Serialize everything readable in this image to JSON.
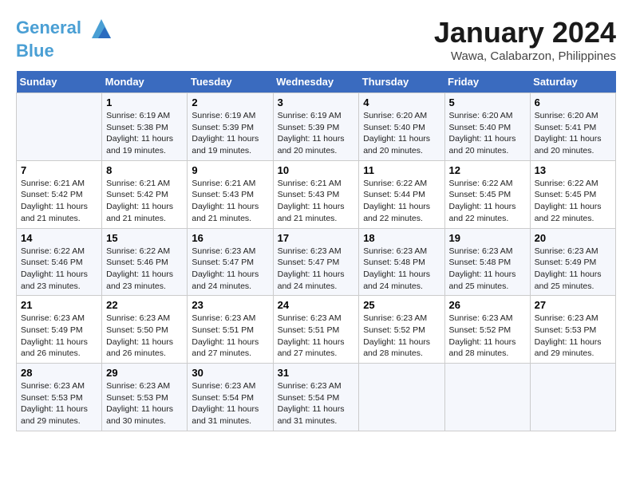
{
  "header": {
    "logo_line1": "General",
    "logo_line2": "Blue",
    "month_title": "January 2024",
    "subtitle": "Wawa, Calabarzon, Philippines"
  },
  "weekdays": [
    "Sunday",
    "Monday",
    "Tuesday",
    "Wednesday",
    "Thursday",
    "Friday",
    "Saturday"
  ],
  "weeks": [
    [
      {
        "day": "",
        "sunrise": "",
        "sunset": "",
        "daylight": ""
      },
      {
        "day": "1",
        "sunrise": "Sunrise: 6:19 AM",
        "sunset": "Sunset: 5:38 PM",
        "daylight": "Daylight: 11 hours and 19 minutes."
      },
      {
        "day": "2",
        "sunrise": "Sunrise: 6:19 AM",
        "sunset": "Sunset: 5:39 PM",
        "daylight": "Daylight: 11 hours and 19 minutes."
      },
      {
        "day": "3",
        "sunrise": "Sunrise: 6:19 AM",
        "sunset": "Sunset: 5:39 PM",
        "daylight": "Daylight: 11 hours and 20 minutes."
      },
      {
        "day": "4",
        "sunrise": "Sunrise: 6:20 AM",
        "sunset": "Sunset: 5:40 PM",
        "daylight": "Daylight: 11 hours and 20 minutes."
      },
      {
        "day": "5",
        "sunrise": "Sunrise: 6:20 AM",
        "sunset": "Sunset: 5:40 PM",
        "daylight": "Daylight: 11 hours and 20 minutes."
      },
      {
        "day": "6",
        "sunrise": "Sunrise: 6:20 AM",
        "sunset": "Sunset: 5:41 PM",
        "daylight": "Daylight: 11 hours and 20 minutes."
      }
    ],
    [
      {
        "day": "7",
        "sunrise": "Sunrise: 6:21 AM",
        "sunset": "Sunset: 5:42 PM",
        "daylight": "Daylight: 11 hours and 21 minutes."
      },
      {
        "day": "8",
        "sunrise": "Sunrise: 6:21 AM",
        "sunset": "Sunset: 5:42 PM",
        "daylight": "Daylight: 11 hours and 21 minutes."
      },
      {
        "day": "9",
        "sunrise": "Sunrise: 6:21 AM",
        "sunset": "Sunset: 5:43 PM",
        "daylight": "Daylight: 11 hours and 21 minutes."
      },
      {
        "day": "10",
        "sunrise": "Sunrise: 6:21 AM",
        "sunset": "Sunset: 5:43 PM",
        "daylight": "Daylight: 11 hours and 21 minutes."
      },
      {
        "day": "11",
        "sunrise": "Sunrise: 6:22 AM",
        "sunset": "Sunset: 5:44 PM",
        "daylight": "Daylight: 11 hours and 22 minutes."
      },
      {
        "day": "12",
        "sunrise": "Sunrise: 6:22 AM",
        "sunset": "Sunset: 5:45 PM",
        "daylight": "Daylight: 11 hours and 22 minutes."
      },
      {
        "day": "13",
        "sunrise": "Sunrise: 6:22 AM",
        "sunset": "Sunset: 5:45 PM",
        "daylight": "Daylight: 11 hours and 22 minutes."
      }
    ],
    [
      {
        "day": "14",
        "sunrise": "Sunrise: 6:22 AM",
        "sunset": "Sunset: 5:46 PM",
        "daylight": "Daylight: 11 hours and 23 minutes."
      },
      {
        "day": "15",
        "sunrise": "Sunrise: 6:22 AM",
        "sunset": "Sunset: 5:46 PM",
        "daylight": "Daylight: 11 hours and 23 minutes."
      },
      {
        "day": "16",
        "sunrise": "Sunrise: 6:23 AM",
        "sunset": "Sunset: 5:47 PM",
        "daylight": "Daylight: 11 hours and 24 minutes."
      },
      {
        "day": "17",
        "sunrise": "Sunrise: 6:23 AM",
        "sunset": "Sunset: 5:47 PM",
        "daylight": "Daylight: 11 hours and 24 minutes."
      },
      {
        "day": "18",
        "sunrise": "Sunrise: 6:23 AM",
        "sunset": "Sunset: 5:48 PM",
        "daylight": "Daylight: 11 hours and 24 minutes."
      },
      {
        "day": "19",
        "sunrise": "Sunrise: 6:23 AM",
        "sunset": "Sunset: 5:48 PM",
        "daylight": "Daylight: 11 hours and 25 minutes."
      },
      {
        "day": "20",
        "sunrise": "Sunrise: 6:23 AM",
        "sunset": "Sunset: 5:49 PM",
        "daylight": "Daylight: 11 hours and 25 minutes."
      }
    ],
    [
      {
        "day": "21",
        "sunrise": "Sunrise: 6:23 AM",
        "sunset": "Sunset: 5:49 PM",
        "daylight": "Daylight: 11 hours and 26 minutes."
      },
      {
        "day": "22",
        "sunrise": "Sunrise: 6:23 AM",
        "sunset": "Sunset: 5:50 PM",
        "daylight": "Daylight: 11 hours and 26 minutes."
      },
      {
        "day": "23",
        "sunrise": "Sunrise: 6:23 AM",
        "sunset": "Sunset: 5:51 PM",
        "daylight": "Daylight: 11 hours and 27 minutes."
      },
      {
        "day": "24",
        "sunrise": "Sunrise: 6:23 AM",
        "sunset": "Sunset: 5:51 PM",
        "daylight": "Daylight: 11 hours and 27 minutes."
      },
      {
        "day": "25",
        "sunrise": "Sunrise: 6:23 AM",
        "sunset": "Sunset: 5:52 PM",
        "daylight": "Daylight: 11 hours and 28 minutes."
      },
      {
        "day": "26",
        "sunrise": "Sunrise: 6:23 AM",
        "sunset": "Sunset: 5:52 PM",
        "daylight": "Daylight: 11 hours and 28 minutes."
      },
      {
        "day": "27",
        "sunrise": "Sunrise: 6:23 AM",
        "sunset": "Sunset: 5:53 PM",
        "daylight": "Daylight: 11 hours and 29 minutes."
      }
    ],
    [
      {
        "day": "28",
        "sunrise": "Sunrise: 6:23 AM",
        "sunset": "Sunset: 5:53 PM",
        "daylight": "Daylight: 11 hours and 29 minutes."
      },
      {
        "day": "29",
        "sunrise": "Sunrise: 6:23 AM",
        "sunset": "Sunset: 5:53 PM",
        "daylight": "Daylight: 11 hours and 30 minutes."
      },
      {
        "day": "30",
        "sunrise": "Sunrise: 6:23 AM",
        "sunset": "Sunset: 5:54 PM",
        "daylight": "Daylight: 11 hours and 31 minutes."
      },
      {
        "day": "31",
        "sunrise": "Sunrise: 6:23 AM",
        "sunset": "Sunset: 5:54 PM",
        "daylight": "Daylight: 11 hours and 31 minutes."
      },
      {
        "day": "",
        "sunrise": "",
        "sunset": "",
        "daylight": ""
      },
      {
        "day": "",
        "sunrise": "",
        "sunset": "",
        "daylight": ""
      },
      {
        "day": "",
        "sunrise": "",
        "sunset": "",
        "daylight": ""
      }
    ]
  ]
}
